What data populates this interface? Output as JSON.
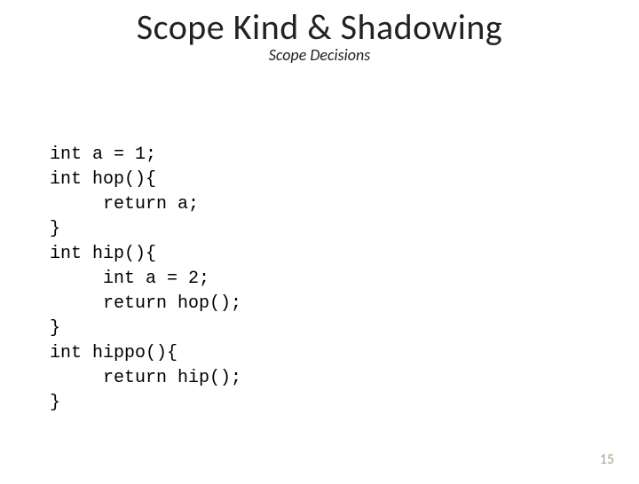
{
  "slide": {
    "title": "Scope Kind & Shadowing",
    "subtitle": "Scope Decisions",
    "page_number": "15"
  },
  "code": {
    "lines": [
      "int a = 1;",
      "int hop(){",
      "     return a;",
      "}",
      "int hip(){",
      "     int a = 2;",
      "     return hop();",
      "}",
      "int hippo(){",
      "     return hip();",
      "}"
    ]
  }
}
